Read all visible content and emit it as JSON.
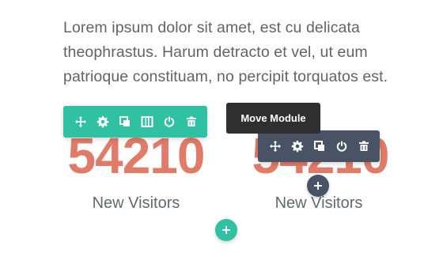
{
  "paragraph": {
    "text": "Lorem ipsum dolor sit amet, est cu delicata theophrastus. Harum detracto et vel, ut eum patrioque constituam, no percipit torquatos est."
  },
  "counters": [
    {
      "number": "54210",
      "caption": "New Visitors"
    },
    {
      "number": "54210",
      "caption": "New Visitors"
    }
  ],
  "tooltip": {
    "text": "Move Module"
  },
  "toolbars": {
    "row": {
      "color": "#2fc1a2",
      "icons": [
        "move-icon",
        "gear-icon",
        "duplicate-icon",
        "columns-icon",
        "power-icon",
        "trash-icon"
      ]
    },
    "module": {
      "color": "#4a5366",
      "icons": [
        "move-icon",
        "gear-icon",
        "duplicate-icon",
        "power-icon",
        "trash-icon"
      ]
    }
  },
  "colors": {
    "counter_number": "#e17b67",
    "teal": "#2fc1a2",
    "dark": "#4a5366",
    "tooltip_bg": "#2f2f2f"
  },
  "add_buttons": [
    {
      "icon": "plus-icon",
      "color": "#4a5366"
    },
    {
      "icon": "plus-icon",
      "color": "#2fc1a2"
    }
  ]
}
